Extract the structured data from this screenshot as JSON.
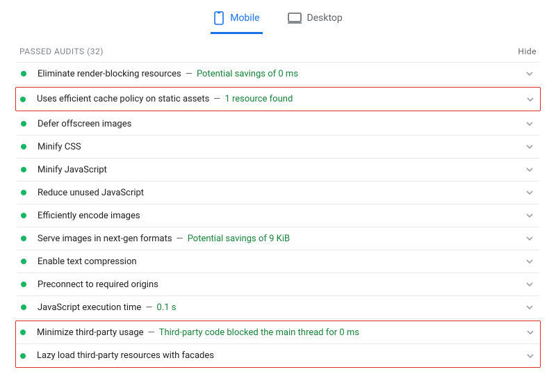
{
  "tabs": {
    "mobile": "Mobile",
    "desktop": "Desktop"
  },
  "section": {
    "title": "PASSED AUDITS",
    "count": "32",
    "hide": "Hide"
  },
  "audits": [
    {
      "label": "Eliminate render-blocking resources",
      "note": "Potential savings of 0 ms"
    },
    {
      "label": "Uses efficient cache policy on static assets",
      "note": "1 resource found"
    },
    {
      "label": "Defer offscreen images",
      "note": ""
    },
    {
      "label": "Minify CSS",
      "note": ""
    },
    {
      "label": "Minify JavaScript",
      "note": ""
    },
    {
      "label": "Reduce unused JavaScript",
      "note": ""
    },
    {
      "label": "Efficiently encode images",
      "note": ""
    },
    {
      "label": "Serve images in next-gen formats",
      "note": "Potential savings of 9 KiB"
    },
    {
      "label": "Enable text compression",
      "note": ""
    },
    {
      "label": "Preconnect to required origins",
      "note": ""
    },
    {
      "label": "JavaScript execution time",
      "note": "0.1 s"
    },
    {
      "label": "Minimize third-party usage",
      "note": "Third-party code blocked the main thread for 0 ms"
    },
    {
      "label": "Lazy load third-party resources with facades",
      "note": ""
    }
  ]
}
